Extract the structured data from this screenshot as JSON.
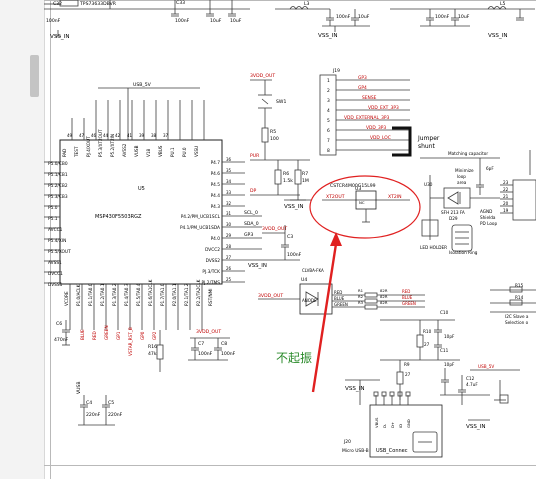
{
  "page": {
    "note": "schematic preview"
  },
  "top": {
    "c32": "C32",
    "tp_part": "TPS73633DBVR",
    "c33": "C33",
    "c33_val": "100nF",
    "c_10uf_a": "10uF",
    "c_10uf_b": "10uF",
    "c_100nf_top": "100nF",
    "l3": "L3",
    "l5": "L5",
    "c_100nf_a": "100nF",
    "c_10uf_c": "10uF",
    "c_100nf_b": "100nF",
    "c_10uf_d": "10uF",
    "vss_in_1": "VSS_IN",
    "vss_in_2": "VSS_IN",
    "vss_in_3": "VSS_IN"
  },
  "mcu": {
    "usb_5v": "USB_5V",
    "ref": "U5",
    "part": "MSP430F5503RGZ",
    "top_pins": [
      "PAD",
      "TEST",
      "PJ.4/XOUT",
      "P5.3/XT2OUT",
      "P5.2/XT2IN",
      "AVSS2",
      "VUSB",
      "V18",
      "VBUS",
      "PU.1",
      "PU.0",
      "VSSU"
    ],
    "top_pin_numbers": [
      "49",
      "47",
      "46",
      "44",
      "42",
      "41",
      "39",
      "38",
      "37"
    ],
    "left_pins": [
      "P5.0/CB0",
      "P5.1/CB1",
      "P5.2/CB2",
      "P5.3/CB3",
      "P5.0",
      "P5.1",
      "AVCC1",
      "P5.4/XIN",
      "P5.5/XOUT",
      "AVSS1",
      "DVCC1",
      "DVSS1"
    ],
    "right_pins": [
      "P4.7",
      "P4.6",
      "P4.5",
      "P4.4",
      "P4.3",
      "P4.2/PM_UCB1SCL",
      "P4.1/PM_UCB1SDA",
      "P4.0",
      "DVCC2",
      "DVSS2",
      "PJ.3/TCK",
      "PJ.2/TMS"
    ],
    "right_pin_numbers": [
      "36",
      "35",
      "34",
      "33",
      "32",
      "31",
      "30",
      "29",
      "28",
      "27",
      "26",
      "25"
    ],
    "bottom_pins": [
      "VCORE",
      "P1.0/ACLK",
      "P1.1/TA0.0",
      "P1.2/TA0.1",
      "P1.3/TA0.2",
      "P1.4/TA0.3",
      "P1.5/TA0.4",
      "P1.6/TA1CLK",
      "P1.7/TA1.0",
      "P2.0/TA1.1",
      "P2.1/TA1.2",
      "P2.2/TA2CLK",
      "RST/NMI",
      "PJ.0/TDO",
      "PJ.1/TDI"
    ],
    "net_scl": "SCL_0",
    "net_sda": "SDA_0",
    "net_gp3": "GP3",
    "net_3v_out": "3VDD_OUT",
    "c3": "C3",
    "c3_val": "100nF",
    "vss_in": "VSS_IN"
  },
  "bottom_left": {
    "c6": "C6",
    "c6_val": "470nF",
    "r16": "R16",
    "r16_val": "47k",
    "c7": "C7",
    "c7_val": "100nF",
    "c8": "C8",
    "c8_val": "100nF",
    "vusb": "VUSB",
    "c4": "C4",
    "c4_val": "220nF",
    "c5": "C5",
    "c5_val": "220nF",
    "net_3v": "3VDD_OUT",
    "nets": [
      "BLUE",
      "RED",
      "GREEN",
      "GP1",
      "VSTAR_RST_B",
      "GP0",
      "GP2"
    ]
  },
  "switch": {
    "net_3v": "3VDD_OUT",
    "sw": "SW1",
    "r5": "R5",
    "r5_val": "100",
    "pur": "PUR",
    "dp": "DP",
    "r6": "R6",
    "r6_val": "1.5k",
    "r7": "R7",
    "r7_val": "1M",
    "vss_in": "VSS_IN"
  },
  "header": {
    "ref": "J19",
    "pins": [
      "1",
      "2",
      "3",
      "4",
      "5",
      "6",
      "7",
      "8"
    ],
    "nets": [
      "GP3",
      "GP4",
      "SENSE",
      "VDD_EXT_3P3",
      "VDD_EXTERNAL_3P3",
      "VDD_3P3",
      "VDD_LOC"
    ],
    "jumper_label": "Jumper",
    "jumper_label2": "shunt"
  },
  "crystal": {
    "part": "CSTCR4M00G15L99",
    "ref": "U3",
    "xt2out": "XT2OUT",
    "xt2in": "XT2IN",
    "nc": "NC"
  },
  "annotation": {
    "chinese_text": "不起振"
  },
  "led": {
    "ref": "U4",
    "part": "CLVBA-FKA",
    "anode": "ANODE",
    "colors": [
      "RED",
      "BLUE",
      "GREEN"
    ],
    "resistors": [
      "R1",
      "R2",
      "R3"
    ],
    "res_vals": [
      "82R",
      "82R",
      "82R"
    ],
    "nets": [
      "RED",
      "BLUE",
      "GREEN"
    ],
    "net_3v": "3VDD_OUT"
  },
  "right": {
    "matching": "Matching capacitor",
    "c_6pf": "6pF",
    "minimize1": "Minimize",
    "minimize2": "loop",
    "minimize3": "area",
    "u30": "U30",
    "d_part": "SFH 213 FA",
    "d_ref": "D29",
    "led_holder": "LED HOLDER",
    "isolation": "Isolation Ring",
    "agnd1": "AGND",
    "agnd2": "Shielda",
    "agnd3": "PD Loop",
    "c10": "C10",
    "c10_val": "10pF",
    "r10": "R10",
    "r10_val": "27",
    "c11": "C11",
    "c11_val": "10pF",
    "r9": "R9",
    "r9_val": "27",
    "c12": "C12",
    "c12_val": "4.7uF",
    "usb_5v": "USB_5V",
    "r15": "R15",
    "r14": "R14",
    "i2c1": "I2C Slave a",
    "i2c2": "Selection o",
    "vss_in_1": "VSS_IN",
    "vss_in_2": "VSS_IN",
    "pin_nums": [
      "23",
      "22",
      "21",
      "20",
      "19"
    ]
  },
  "usb": {
    "ref": "J20",
    "part": "Micro USB-B",
    "connector_label": "USB_Connec",
    "pins": [
      "VBUS",
      "D-",
      "D+",
      "ID",
      "GND"
    ],
    "vss_in": "VSS_IN"
  },
  "colors": {
    "wire": "#3c3c3c",
    "net_red": "#c00000",
    "annotation_red": "#e02020",
    "note_green": "#2a8a2a",
    "jumper": "#111111"
  }
}
